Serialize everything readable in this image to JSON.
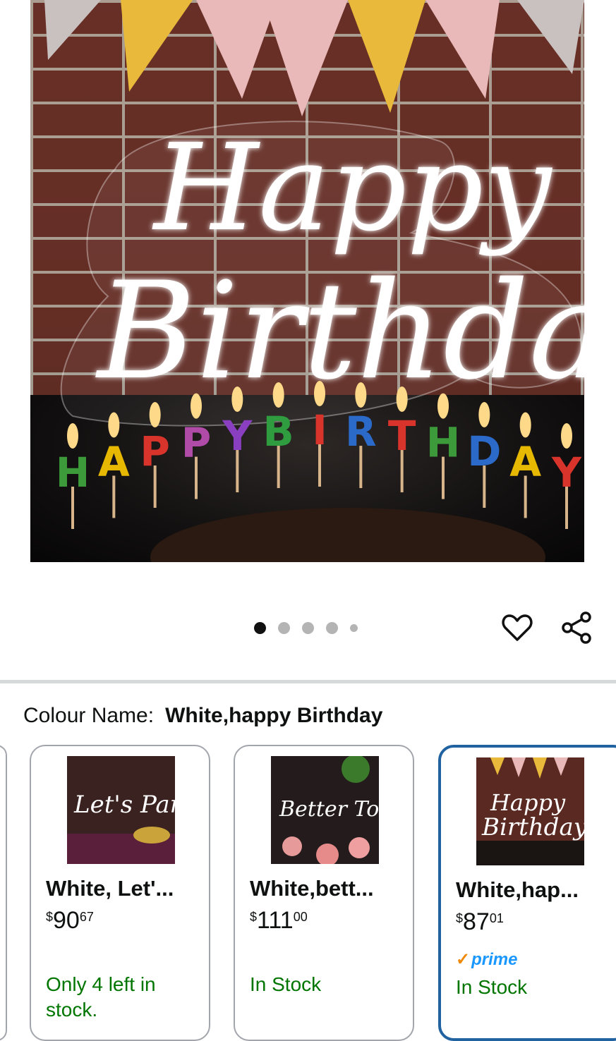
{
  "product_image": {
    "neon_line1": "Happy",
    "neon_line2": "Birthday",
    "candle_letters": [
      "H",
      "A",
      "P",
      "P",
      "Y",
      "B",
      "I",
      "R",
      "T",
      "H",
      "D",
      "A",
      "Y"
    ],
    "candle_colors": [
      "#3c9a3a",
      "#e6b800",
      "#d9342b",
      "#b04ca8",
      "#8a3fc1",
      "#2f9c3f",
      "#d9342b",
      "#2b6ac9",
      "#d9342b",
      "#3c9a3a",
      "#2b6ac9",
      "#e6b800",
      "#d9342b"
    ],
    "pennant_colors": [
      "#c9c1bf",
      "#e8b93a",
      "#e9b8b8",
      "#e8b93a",
      "#e9b8b8",
      "#e9b8b8",
      "#e8b93a",
      "#c9c1bf"
    ]
  },
  "carousel": {
    "total": 5,
    "active": 0
  },
  "actions": {
    "favorite_icon": "heart-icon",
    "share_icon": "share-icon"
  },
  "colour": {
    "label": "Colour Name:",
    "value": "White,happy Birthday"
  },
  "variants": [
    {
      "name": "White, Let'...",
      "thumb_text": "Let's Party",
      "price": {
        "currency": "$",
        "whole": "90",
        "fraction": "67"
      },
      "stock": "Only 4 left in stock.",
      "selected": false
    },
    {
      "name": "White,bett...",
      "thumb_text": "Better Together",
      "price": {
        "currency": "$",
        "whole": "111",
        "fraction": "00"
      },
      "stock": "In Stock",
      "selected": false
    },
    {
      "name": "White,hap...",
      "thumb_text": "Happy Birthday",
      "price": {
        "currency": "$",
        "whole": "87",
        "fraction": "01"
      },
      "prime": "prime",
      "stock": "In Stock",
      "selected": true
    }
  ],
  "colors": {
    "accent_selected": "#2162a1",
    "stock_green": "#007600",
    "prime_blue": "#1a98ff",
    "prime_check": "#f08804"
  }
}
